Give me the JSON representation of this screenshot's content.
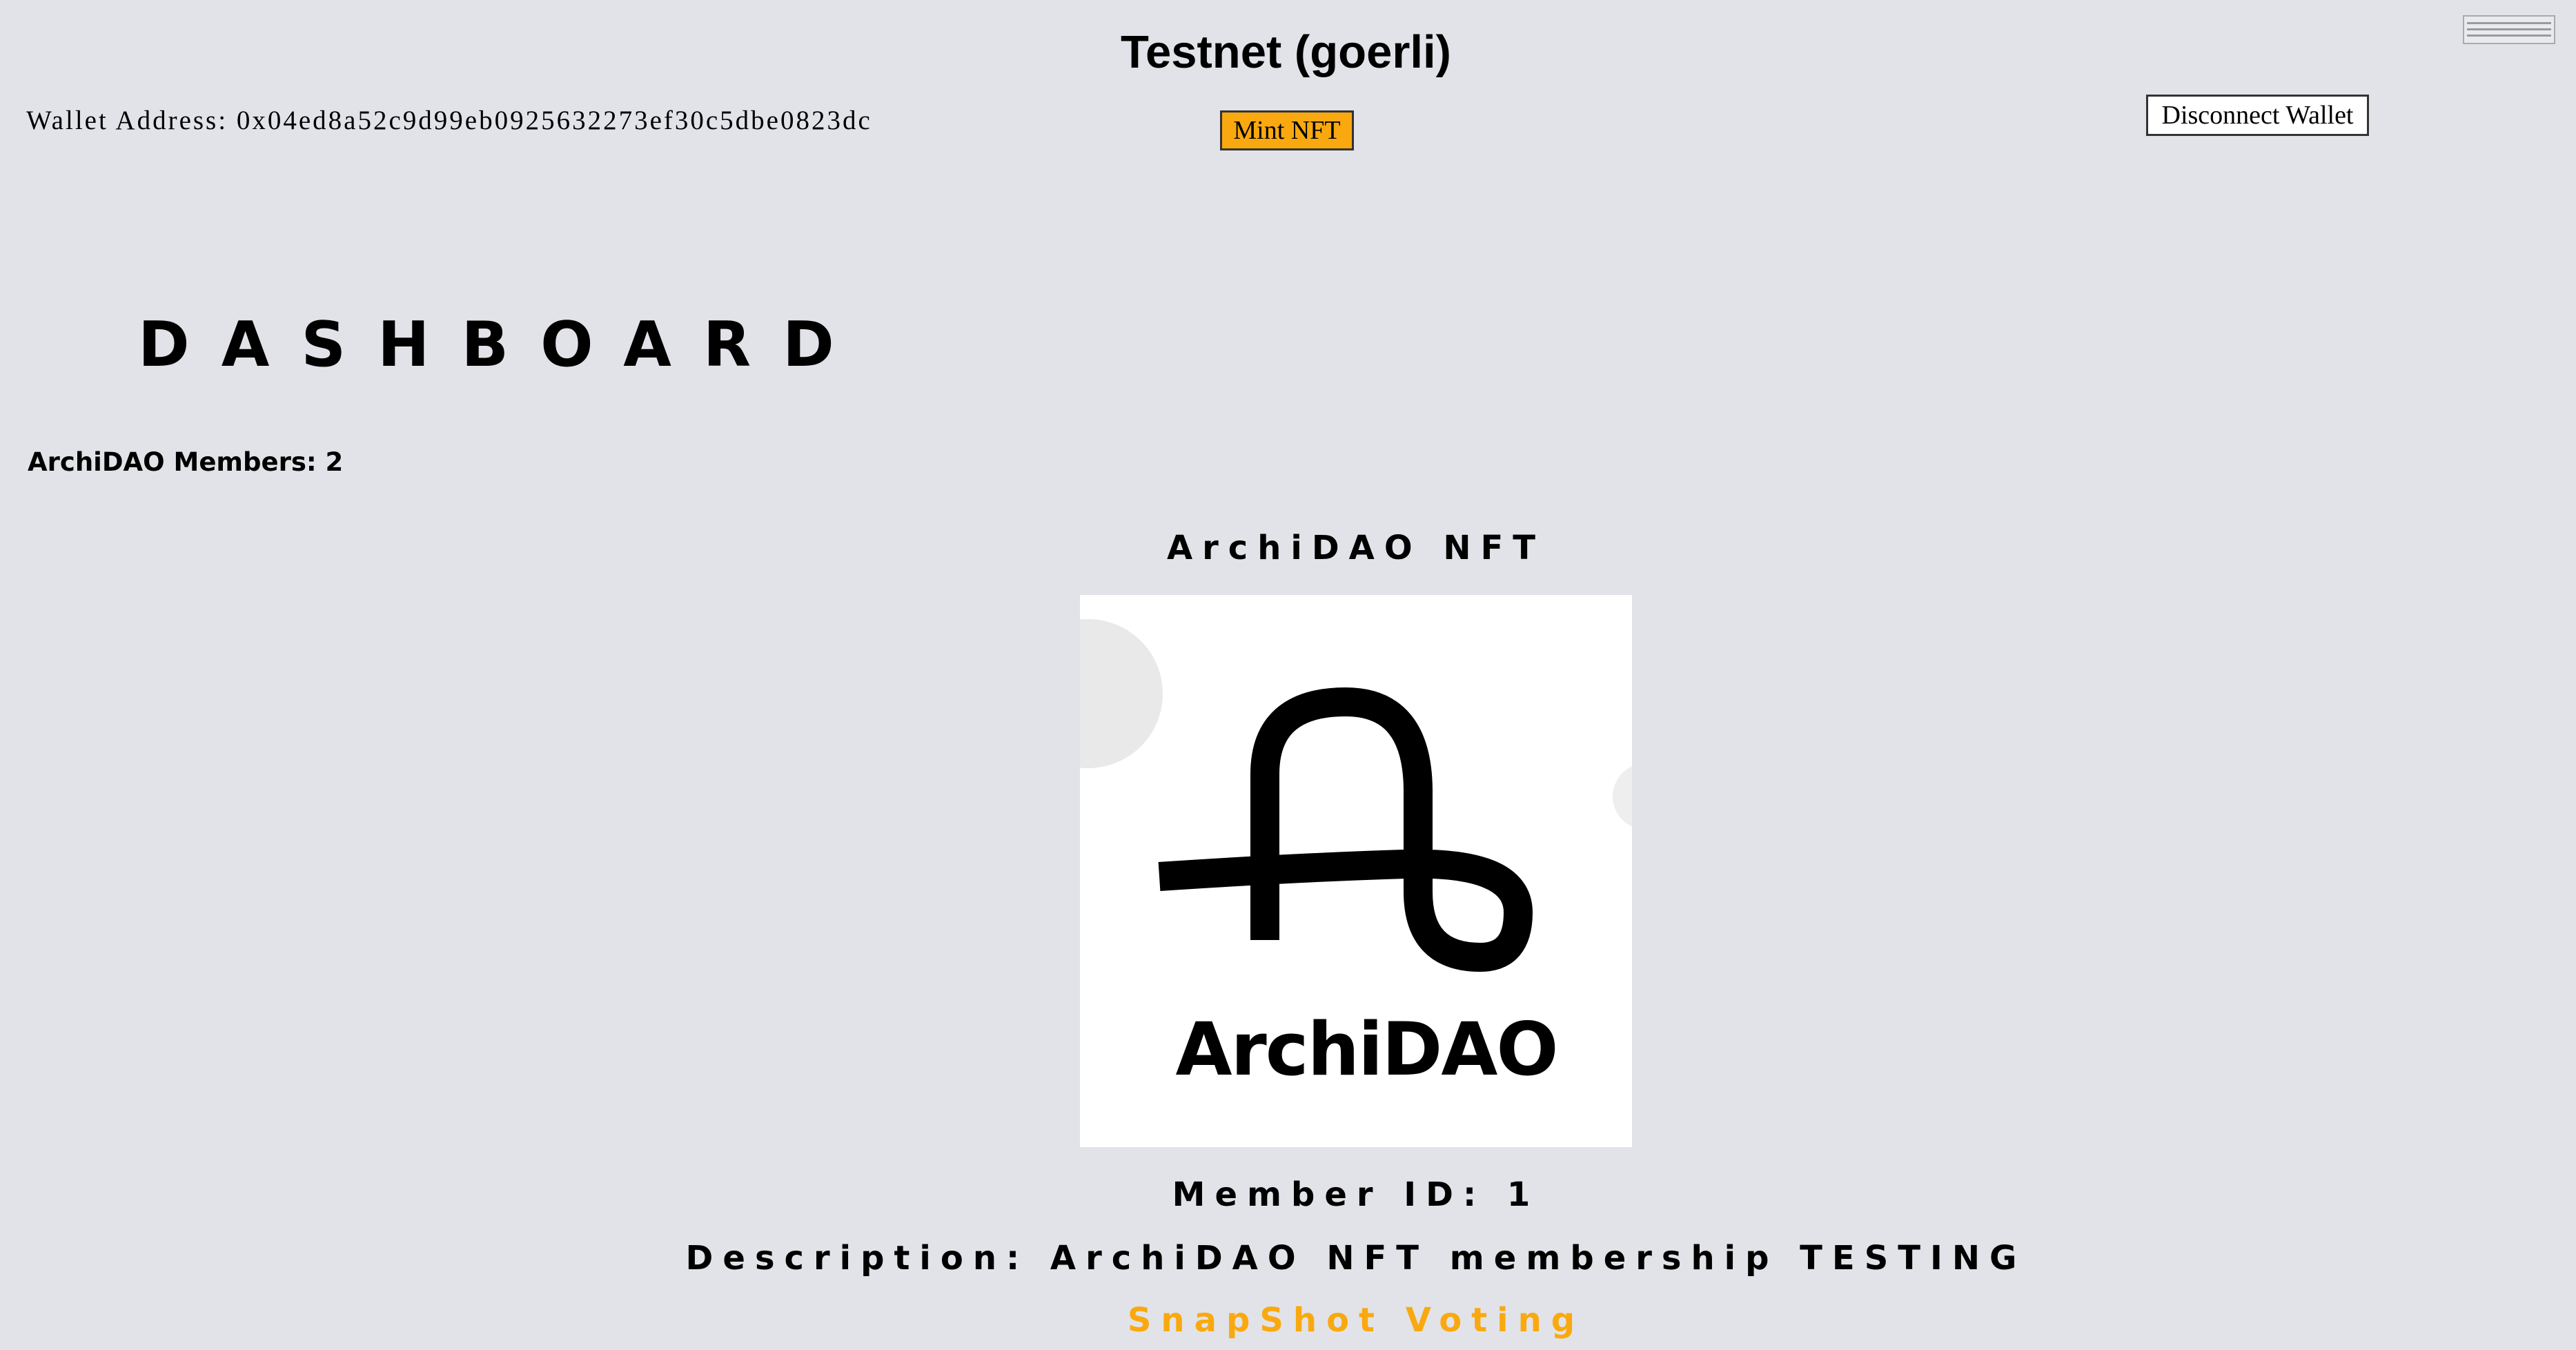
{
  "header": {
    "network_title": "Testnet (goerli)",
    "wallet_label": "Wallet Address:",
    "wallet_address": "0x04ed8a52c9d99eb0925632273ef30c5dbe0823dc",
    "mint_button_label": "Mint NFT",
    "disconnect_button_label": "Disconnect Wallet",
    "menu_icon": "hamburger-menu-icon"
  },
  "dashboard": {
    "title": "DASHBOARD",
    "members_label": "ArchiDAO Members:",
    "members_count": "2"
  },
  "nft": {
    "title": "ArchiDAO NFT",
    "image_logo_text": "ArchiDAO",
    "member_id_label": "Member ID:",
    "member_id": "1",
    "description_label": "Description:",
    "description": "ArchiDAO NFT membership TESTING",
    "snapshot_link_label": "SnapShot Voting"
  },
  "colors": {
    "background": "#e2e3e8",
    "accent_orange": "#f9a90f",
    "text": "#000000",
    "card_background": "#ffffff"
  }
}
